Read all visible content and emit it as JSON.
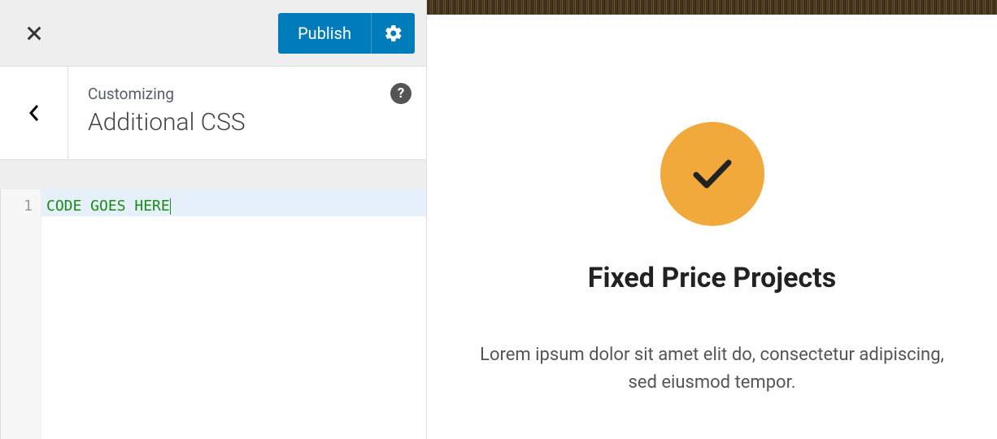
{
  "sidebar": {
    "publish_label": "Publish",
    "eyebrow": "Customizing",
    "title": "Additional CSS"
  },
  "editor": {
    "line_number": "1",
    "code": "CODE GOES HERE"
  },
  "preview": {
    "heading": "Fixed Price Projects",
    "body": "Lorem ipsum dolor sit amet elit do, consectetur adipiscing, sed eiusmod tempor."
  }
}
